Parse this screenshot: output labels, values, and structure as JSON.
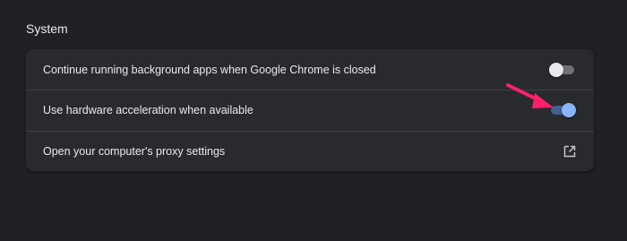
{
  "section": {
    "title": "System"
  },
  "settings": [
    {
      "label": "Continue running background apps when Google Chrome is closed",
      "control": "toggle",
      "enabled": false
    },
    {
      "label": "Use hardware acceleration when available",
      "control": "toggle",
      "enabled": true
    },
    {
      "label": "Open your computer's proxy settings",
      "control": "external-link",
      "icon": "open-in-new-icon"
    }
  ],
  "colors": {
    "background": "#202124",
    "card": "#292a2d",
    "text": "#e8eaed",
    "toggle_on_knob": "#8ab4f8",
    "toggle_on_track": "#41608f",
    "toggle_off_knob": "#e8eaed",
    "toggle_off_track": "#6f7175",
    "annotation_arrow": "#ff1f6b"
  },
  "annotation": {
    "type": "arrow",
    "points_to": "hardware-acceleration-toggle"
  }
}
